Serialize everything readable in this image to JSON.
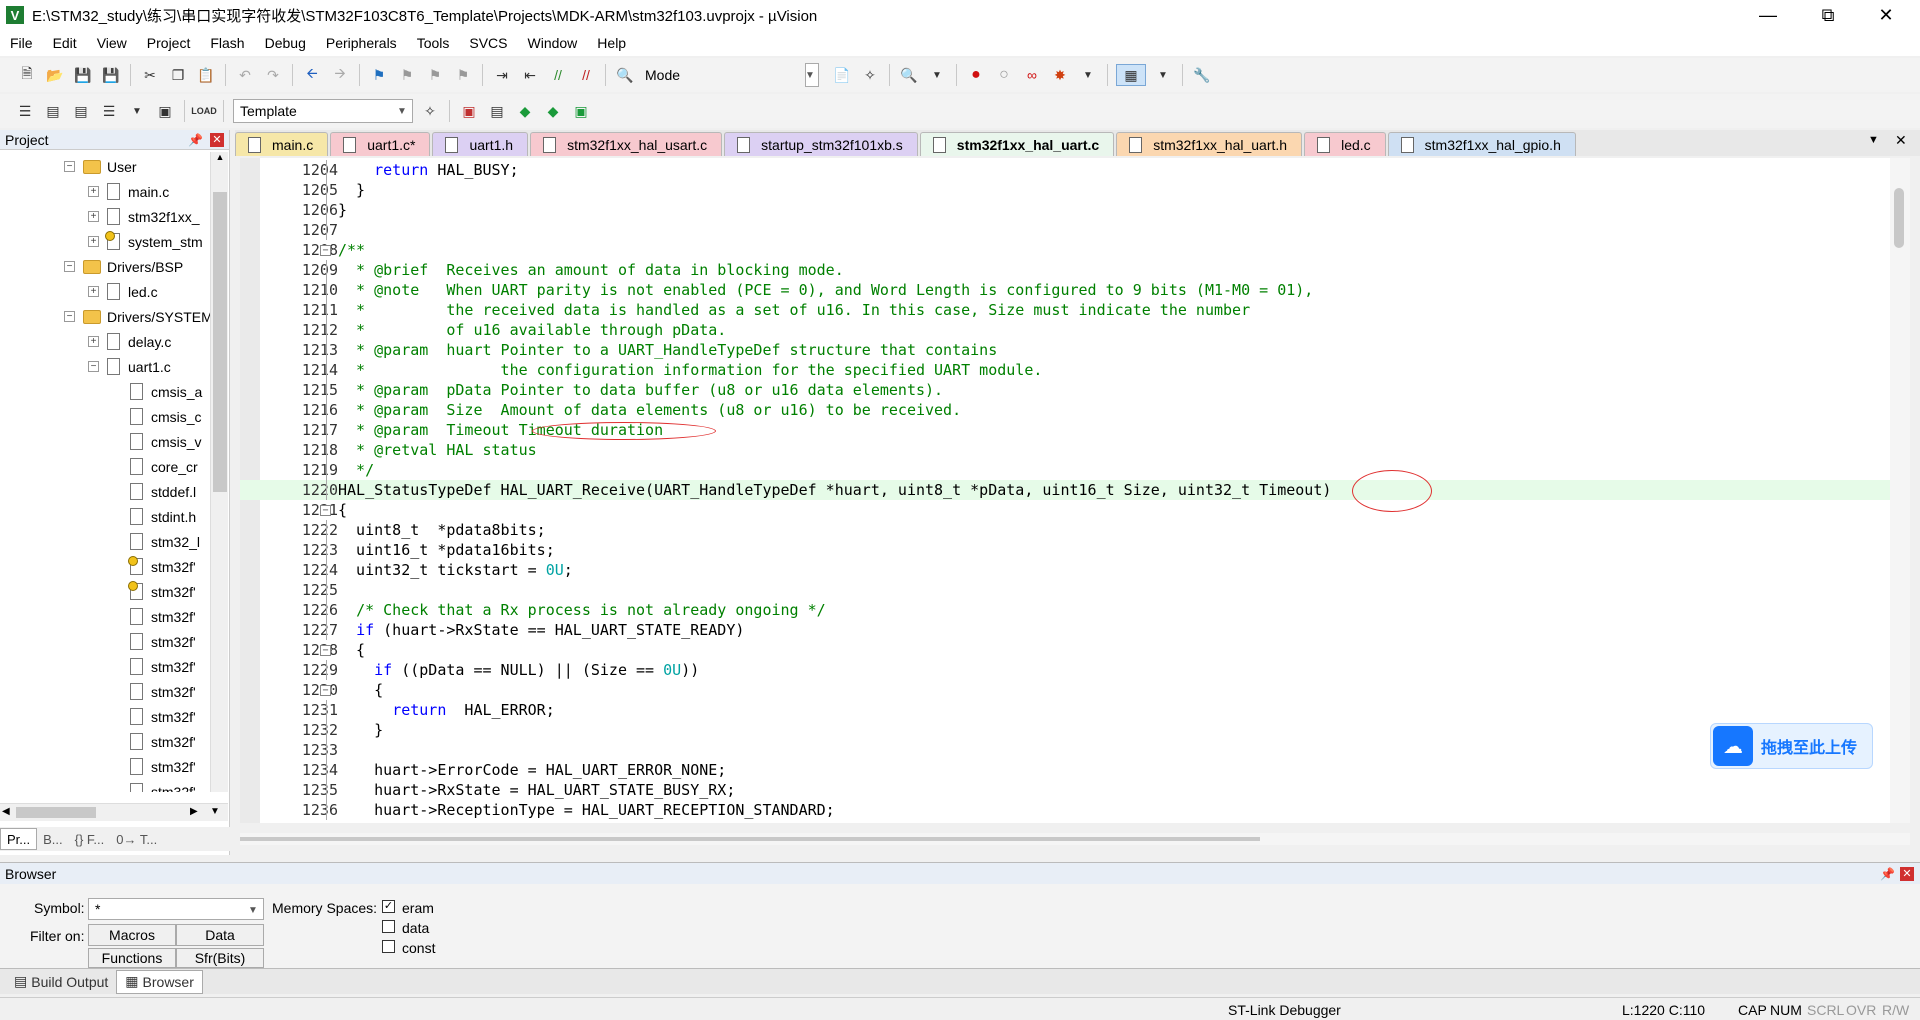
{
  "window": {
    "title": "E:\\STM32_study\\练习\\串口实现字符收发\\STM32F103C8T6_Template\\Projects\\MDK-ARM\\stm32f103.uvprojx - µVision",
    "icon_letter": "V"
  },
  "menu": [
    "File",
    "Edit",
    "View",
    "Project",
    "Flash",
    "Debug",
    "Peripherals",
    "Tools",
    "SVCS",
    "Window",
    "Help"
  ],
  "toolbar": {
    "mode_label": "Mode",
    "target_value": "Template"
  },
  "project_panel": {
    "title": "Project",
    "tree": [
      {
        "label": "User",
        "type": "folder",
        "toggle": "−"
      },
      {
        "label": "main.c",
        "type": "file",
        "toggle": "+"
      },
      {
        "label": "stm32f1xx_",
        "type": "file",
        "toggle": "+"
      },
      {
        "label": "system_stm",
        "type": "keyfile",
        "toggle": "+"
      },
      {
        "label": "Drivers/BSP",
        "type": "folder",
        "toggle": "−"
      },
      {
        "label": "led.c",
        "type": "file",
        "toggle": "+"
      },
      {
        "label": "Drivers/SYSTEM",
        "type": "folder",
        "toggle": "−"
      },
      {
        "label": "delay.c",
        "type": "file",
        "toggle": "+"
      },
      {
        "label": "uart1.c",
        "type": "file",
        "toggle": "−"
      },
      {
        "label": "cmsis_a",
        "type": "file"
      },
      {
        "label": "cmsis_c",
        "type": "file"
      },
      {
        "label": "cmsis_v",
        "type": "file"
      },
      {
        "label": "core_cr",
        "type": "file"
      },
      {
        "label": "stddef.l",
        "type": "file"
      },
      {
        "label": "stdint.h",
        "type": "file"
      },
      {
        "label": "stm32_l",
        "type": "file"
      },
      {
        "label": "stm32f'",
        "type": "keyfile"
      },
      {
        "label": "stm32f'",
        "type": "keyfile"
      },
      {
        "label": "stm32f'",
        "type": "file"
      },
      {
        "label": "stm32f'",
        "type": "file"
      },
      {
        "label": "stm32f'",
        "type": "file"
      },
      {
        "label": "stm32f'",
        "type": "file"
      },
      {
        "label": "stm32f'",
        "type": "file"
      },
      {
        "label": "stm32f'",
        "type": "file"
      },
      {
        "label": "stm32f'",
        "type": "file"
      },
      {
        "label": "stm32f'",
        "type": "file"
      }
    ],
    "tabs": [
      "Pr...",
      "B...",
      "{} F...",
      "0→ T..."
    ]
  },
  "file_tabs": [
    {
      "label": "main.c",
      "color": "#f6e7a8"
    },
    {
      "label": "uart1.c*",
      "color": "#f7c9cf"
    },
    {
      "label": "uart1.h",
      "color": "#dcd0f3"
    },
    {
      "label": "stm32f1xx_hal_usart.c",
      "color": "#f7c9cf"
    },
    {
      "label": "startup_stm32f101xb.s",
      "color": "#dcd0f3"
    },
    {
      "label": "stm32f1xx_hal_uart.c",
      "color": "#e9f6ec",
      "active": true
    },
    {
      "label": "stm32f1xx_hal_uart.h",
      "color": "#fbd7b0"
    },
    {
      "label": "led.c",
      "color": "#f7c9cf"
    },
    {
      "label": "stm32f1xx_hal_gpio.h",
      "color": "#cfe0f3"
    }
  ],
  "code": [
    {
      "n": "1204",
      "fold": "",
      "parts": [
        [
          "",
          "    "
        ],
        [
          "kw",
          "return"
        ],
        [
          "",
          " HAL_BUSY;"
        ]
      ]
    },
    {
      "n": "1205",
      "fold": "",
      "parts": [
        [
          "",
          "  }"
        ]
      ]
    },
    {
      "n": "1206",
      "fold": "",
      "parts": [
        [
          "",
          "}"
        ]
      ]
    },
    {
      "n": "1207",
      "fold": "",
      "parts": [
        [
          "",
          ""
        ]
      ]
    },
    {
      "n": "1208",
      "fold": "−",
      "parts": [
        [
          "com",
          "/**"
        ]
      ]
    },
    {
      "n": "1209",
      "fold": "",
      "parts": [
        [
          "com",
          "  * @brief  Receives an amount of data in blocking mode."
        ]
      ]
    },
    {
      "n": "1210",
      "fold": "",
      "parts": [
        [
          "com",
          "  * @note   When UART parity is not enabled (PCE = 0), and Word Length is configured to 9 bits (M1-M0 = 01),"
        ]
      ]
    },
    {
      "n": "1211",
      "fold": "",
      "parts": [
        [
          "com",
          "  *         the received data is handled as a set of u16. In this case, Size must indicate the number"
        ]
      ]
    },
    {
      "n": "1212",
      "fold": "",
      "parts": [
        [
          "com",
          "  *         of u16 available through pData."
        ]
      ]
    },
    {
      "n": "1213",
      "fold": "",
      "parts": [
        [
          "com",
          "  * @param  huart Pointer to a UART_HandleTypeDef structure that contains"
        ]
      ]
    },
    {
      "n": "1214",
      "fold": "",
      "parts": [
        [
          "com",
          "  *               the configuration information for the specified UART module."
        ]
      ]
    },
    {
      "n": "1215",
      "fold": "",
      "parts": [
        [
          "com",
          "  * @param  pData Pointer to data buffer (u8 or u16 data elements)."
        ]
      ]
    },
    {
      "n": "1216",
      "fold": "",
      "parts": [
        [
          "com",
          "  * @param  Size  Amount of data elements (u8 or u16) to be received."
        ]
      ]
    },
    {
      "n": "1217",
      "fold": "",
      "parts": [
        [
          "com",
          "  * @param  Timeout Timeout duration"
        ]
      ]
    },
    {
      "n": "1218",
      "fold": "",
      "parts": [
        [
          "com",
          "  * @retval HAL status"
        ]
      ]
    },
    {
      "n": "1219",
      "fold": "",
      "parts": [
        [
          "com",
          "  */"
        ]
      ]
    },
    {
      "n": "1220",
      "fold": "",
      "hl": true,
      "parts": [
        [
          "",
          "HAL_StatusTypeDef HAL_UART_Receive(UART_HandleTypeDef *huart, uint8_t *pData, uint16_t Size, uint32_t Timeout)"
        ]
      ]
    },
    {
      "n": "1221",
      "fold": "−",
      "parts": [
        [
          "",
          "{"
        ]
      ]
    },
    {
      "n": "1222",
      "fold": "",
      "parts": [
        [
          "",
          "  uint8_t  *pdata8bits;"
        ]
      ]
    },
    {
      "n": "1223",
      "fold": "",
      "parts": [
        [
          "",
          "  uint16_t *pdata16bits;"
        ]
      ]
    },
    {
      "n": "1224",
      "fold": "",
      "parts": [
        [
          "",
          "  uint32_t tickstart = "
        ],
        [
          "num",
          "0U"
        ],
        [
          "",
          ";"
        ]
      ]
    },
    {
      "n": "1225",
      "fold": "",
      "parts": [
        [
          "",
          ""
        ]
      ]
    },
    {
      "n": "1226",
      "fold": "",
      "parts": [
        [
          "",
          "  "
        ],
        [
          "com",
          "/* Check that a Rx process is not already ongoing */"
        ]
      ]
    },
    {
      "n": "1227",
      "fold": "",
      "parts": [
        [
          "",
          "  "
        ],
        [
          "kw",
          "if"
        ],
        [
          "",
          " (huart->RxState == HAL_UART_STATE_READY)"
        ]
      ]
    },
    {
      "n": "1228",
      "fold": "−",
      "parts": [
        [
          "",
          "  {"
        ]
      ]
    },
    {
      "n": "1229",
      "fold": "",
      "parts": [
        [
          "",
          "    "
        ],
        [
          "kw",
          "if"
        ],
        [
          "",
          " ((pData == NULL) || (Size == "
        ],
        [
          "num",
          "0U"
        ],
        [
          "",
          "))"
        ]
      ]
    },
    {
      "n": "1230",
      "fold": "−",
      "parts": [
        [
          "",
          "    {"
        ]
      ]
    },
    {
      "n": "1231",
      "fold": "",
      "parts": [
        [
          "",
          "      "
        ],
        [
          "kw",
          "return"
        ],
        [
          "",
          "  HAL_ERROR;"
        ]
      ]
    },
    {
      "n": "1232",
      "fold": "",
      "parts": [
        [
          "",
          "    }"
        ]
      ]
    },
    {
      "n": "1233",
      "fold": "",
      "parts": [
        [
          "",
          ""
        ]
      ]
    },
    {
      "n": "1234",
      "fold": "",
      "parts": [
        [
          "",
          "    huart->ErrorCode = HAL_UART_ERROR_NONE;"
        ]
      ]
    },
    {
      "n": "1235",
      "fold": "",
      "parts": [
        [
          "",
          "    huart->RxState = HAL_UART_STATE_BUSY_RX;"
        ]
      ]
    },
    {
      "n": "1236",
      "fold": "",
      "parts": [
        [
          "",
          "    huart->ReceptionType = HAL_UART_RECEPTION_STANDARD;"
        ]
      ]
    }
  ],
  "upload": {
    "label": "拖拽至此上传"
  },
  "browser": {
    "title": "Browser",
    "symbol_label": "Symbol:",
    "symbol_value": "*",
    "filter_label": "Filter on:",
    "filter_buttons": [
      "Macros",
      "Data",
      "Functions",
      "Sfr(Bits)"
    ],
    "memory_label": "Memory Spaces:",
    "memory_options": [
      {
        "label": "eram",
        "checked": true
      },
      {
        "label": "data",
        "checked": false
      },
      {
        "label": "const",
        "checked": false
      }
    ]
  },
  "bottom_tabs": [
    "Build Output",
    "Browser"
  ],
  "status": {
    "debugger": "ST-Link Debugger",
    "position": "L:1220 C:110",
    "caps": "CAP",
    "num": "NUM",
    "scrl": "SCRL",
    "ovr": "OVR",
    "rw": "R/W"
  }
}
